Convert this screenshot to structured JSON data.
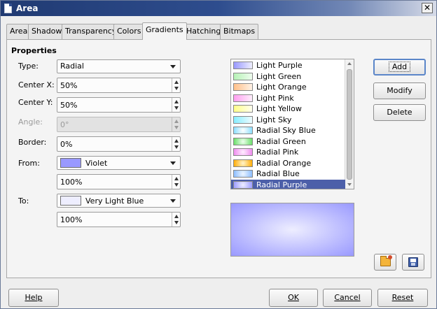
{
  "window": {
    "title": "Area",
    "close_glyph": "✕"
  },
  "tabs": [
    {
      "label": "Area"
    },
    {
      "label": "Shadow"
    },
    {
      "label": "Transparency"
    },
    {
      "label": "Colors"
    },
    {
      "label": "Gradients",
      "active": true
    },
    {
      "label": "Hatching"
    },
    {
      "label": "Bitmaps"
    }
  ],
  "properties": {
    "title": "Properties",
    "type_label": "Type:",
    "type_value": "Radial",
    "center_x_label": "Center X:",
    "center_x_value": "50%",
    "center_y_label": "Center Y:",
    "center_y_value": "50%",
    "angle_label": "Angle:",
    "angle_value": "0°",
    "border_label": "Border:",
    "border_value": "0%",
    "from_label": "From:",
    "from_color_name": "Violet",
    "from_color": "#9999ff",
    "from_intensity": "100%",
    "to_label": "To:",
    "to_color_name": "Very Light Blue",
    "to_color": "#eeeeff",
    "to_intensity": "100%"
  },
  "gradient_list": [
    {
      "name": "Light Purple",
      "from": "#9999ff",
      "to": "#eeeeff",
      "style": "linear"
    },
    {
      "name": "Light Green",
      "from": "#b6f2b6",
      "to": "#eefcee",
      "style": "linear"
    },
    {
      "name": "Light Orange",
      "from": "#ffc08a",
      "to": "#fff2e6",
      "style": "linear"
    },
    {
      "name": "Light Pink",
      "from": "#ff9ff0",
      "to": "#ffeefc",
      "style": "linear"
    },
    {
      "name": "Light Yellow",
      "from": "#ffff88",
      "to": "#ffffee",
      "style": "linear"
    },
    {
      "name": " Light Sky",
      "from": "#88eeff",
      "to": "#eefcff",
      "style": "linear"
    },
    {
      "name": "Radial Sky Blue",
      "from": "#88ddff",
      "to": "#ffffff",
      "style": "radial"
    },
    {
      "name": "Radial Green",
      "from": "#66dd66",
      "to": "#eeffee",
      "style": "radial"
    },
    {
      "name": "Radial Pink",
      "from": "#ee88ee",
      "to": "#ffeeff",
      "style": "radial"
    },
    {
      "name": "Radial Orange",
      "from": "#ffaa00",
      "to": "#fff4cc",
      "style": "radial"
    },
    {
      "name": "Radial Blue",
      "from": "#88bbff",
      "to": "#eef6ff",
      "style": "radial"
    },
    {
      "name": "Radial Purple",
      "from": "#9999ff",
      "to": "#eeeeff",
      "style": "radial",
      "selected": true
    }
  ],
  "buttons": {
    "add": "Add",
    "modify": "Modify",
    "delete": "Delete",
    "help": "Help",
    "ok": "OK",
    "cancel": "Cancel",
    "reset": "Reset"
  },
  "icons": {
    "load": "folder-open-icon",
    "save": "save-icon"
  },
  "colors": {
    "selection": "#4c5fa9",
    "focus_border": "#5b86c9"
  }
}
